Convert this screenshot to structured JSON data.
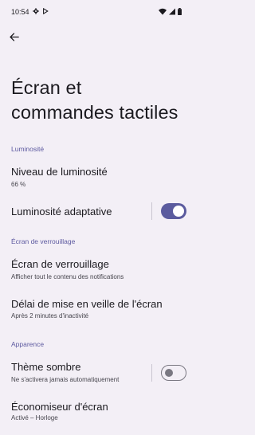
{
  "status_bar": {
    "time": "10:54",
    "icons_left": [
      "gear-icon",
      "play-protect-icon"
    ],
    "icons_right": [
      "wifi-icon",
      "signal-icon",
      "battery-icon"
    ]
  },
  "header": {
    "back_icon": "arrow-back-icon",
    "title": "Écran et commandes tactiles"
  },
  "sections": {
    "brightness": "Luminosité",
    "lock_screen": "Écran de verrouillage",
    "appearance": "Apparence"
  },
  "items": {
    "brightness_level": {
      "label": "Niveau de luminosité",
      "value": "66 %"
    },
    "adaptive_brightness": {
      "label": "Luminosité adaptative",
      "enabled": true
    },
    "lock_screen": {
      "label": "Écran de verrouillage",
      "summary": "Afficher tout le contenu des notifications"
    },
    "screen_timeout": {
      "label": "Délai de mise en veille de l'écran",
      "summary": "Après 2 minutes d'inactivité"
    },
    "dark_theme": {
      "label": "Thème sombre",
      "summary": "Ne s'activera jamais automatiquement",
      "enabled": false
    },
    "screensaver": {
      "label": "Économiseur d'écran",
      "summary": "Activé – Horloge"
    }
  },
  "colors": {
    "background": "#f3eff6",
    "accent": "#5b5b9e",
    "section_header": "#5d5aa0"
  }
}
